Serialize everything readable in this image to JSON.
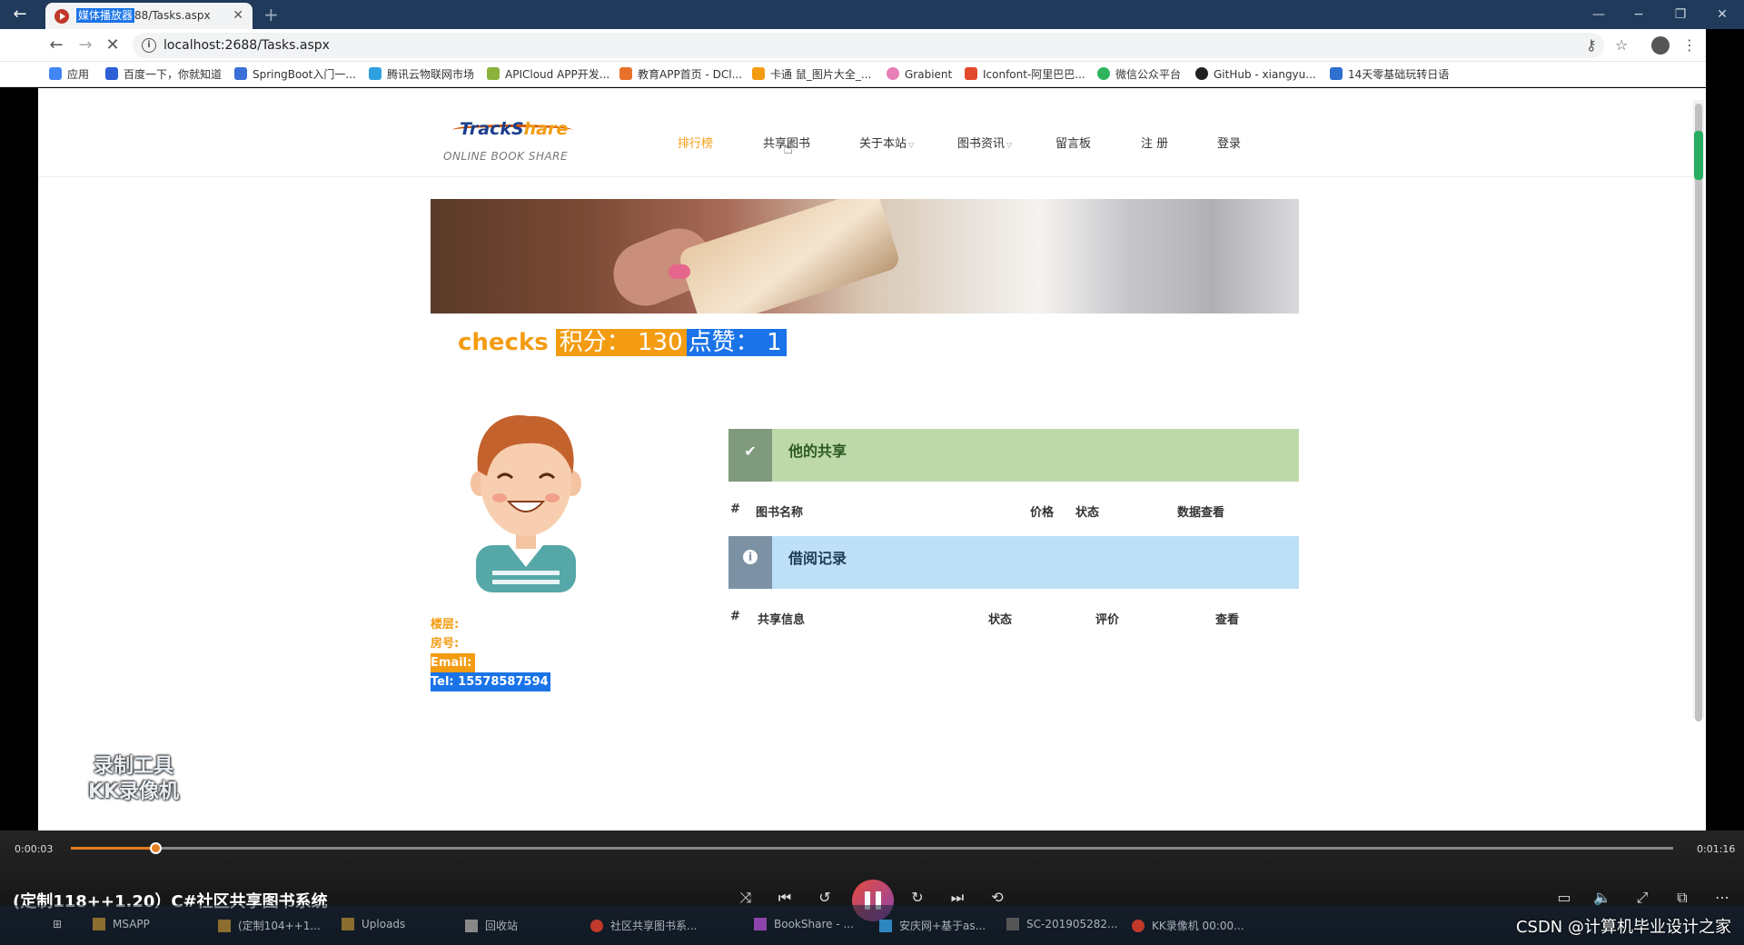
{
  "browser": {
    "tab_label_selected": "媒体播放器",
    "tab_label_rest": "88/Tasks.aspx",
    "url": "localhost:2688/Tasks.aspx",
    "bookmarks": [
      {
        "label": "应用",
        "color": "#4285f4"
      },
      {
        "label": "百度一下，你就知道",
        "color": "#2d5fd6"
      },
      {
        "label": "SpringBoot入门一...",
        "color": "#3b6fd8"
      },
      {
        "label": "腾讯云物联网市场",
        "color": "#2fa0e0"
      },
      {
        "label": "APICloud APP开发...",
        "color": "#8bb33c"
      },
      {
        "label": "教育APP首页 - DCl...",
        "color": "#e8712c"
      },
      {
        "label": "卡通 鼠_图片大全_...",
        "color": "#f39c12"
      },
      {
        "label": "Grabient",
        "color": "#e77fb6"
      },
      {
        "label": "Iconfont-阿里巴巴...",
        "color": "#e24a2b"
      },
      {
        "label": "微信公众平台",
        "color": "#2db55d"
      },
      {
        "label": "GitHub - xiangyu...",
        "color": "#222222"
      },
      {
        "label": "14天零基础玩转日语",
        "color": "#2e6fd0"
      }
    ]
  },
  "site": {
    "logo_brand_a": "TrackS",
    "logo_brand_b": "hare",
    "logo_sub": "ONLINE BOOK SHARE",
    "nav": [
      "排行榜",
      "共享图书",
      "关于本站",
      "图书资讯",
      "留言板",
      "注 册",
      "登录"
    ]
  },
  "user": {
    "name": "checks",
    "points_label": "积分：",
    "points": "130",
    "likes_label": "点赞：",
    "likes": "1",
    "floor_label": "楼层:",
    "room_label": "房号:",
    "email_label": "Email:",
    "tel_label": "Tel:",
    "tel": "15578587594"
  },
  "shares_panel": {
    "title": "他的共享",
    "columns": [
      "#",
      "图书名称",
      "价格",
      "状态",
      "数据查看"
    ]
  },
  "borrow_panel": {
    "title": "借阅记录",
    "columns": [
      "#",
      "共享信息",
      "状态",
      "评价",
      "查看"
    ]
  },
  "watermark": [
    "录制工具",
    "KK录像机"
  ],
  "player": {
    "current_time": "0:00:03",
    "total_time": "0:01:16",
    "progress_fraction": 0.053,
    "video_title": "(定制118++1.20）C#社区共享图书系统",
    "accent_color": "#e67e22"
  },
  "taskbar": {
    "items": [
      "MSAPP",
      "(定制104++1...",
      "Uploads",
      "回收站",
      "社区共享图书系...",
      "BookShare - ...",
      "安庆网+基于as...",
      "SC-201905282...",
      "KK录像机 00:00..."
    ],
    "credit": "CSDN @计算机毕业设计之家"
  }
}
